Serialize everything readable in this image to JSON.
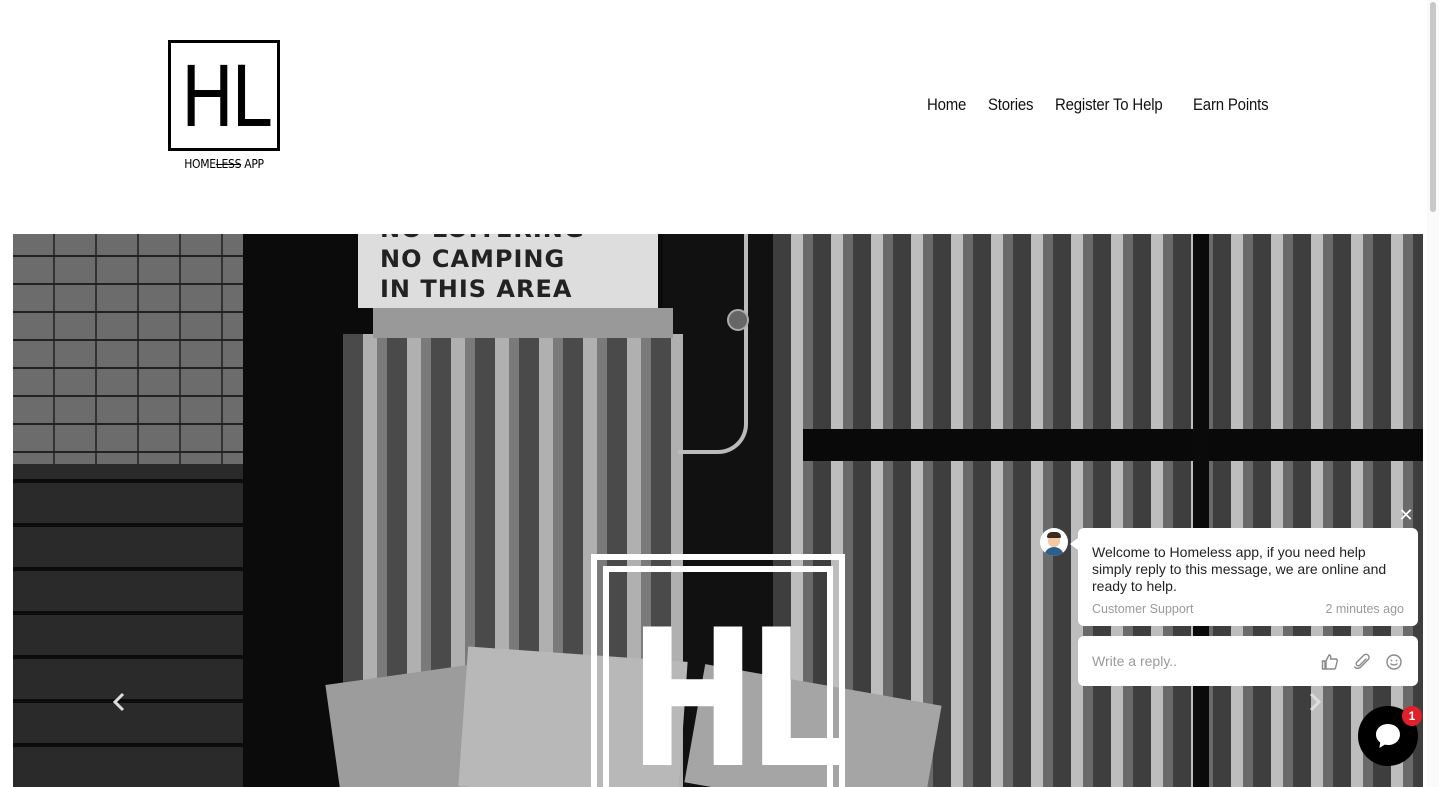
{
  "brand": {
    "logo_letters": "HL",
    "logo_caption_prefix": "HOME",
    "logo_caption_strike": "LESS",
    "logo_caption_suffix": " APP"
  },
  "nav": {
    "items": [
      {
        "label": "Home"
      },
      {
        "label": "Stories"
      },
      {
        "label": "Register To Help"
      },
      {
        "label": "Earn Points"
      }
    ]
  },
  "hero": {
    "sign_lines": [
      "NO LOITERING",
      "NO CAMPING",
      "IN THIS AREA"
    ],
    "logo_letters": "HL",
    "prev_icon": "chevron-left-icon",
    "next_icon": "chevron-right-icon"
  },
  "chat": {
    "message": "Welcome to Homeless app, if you need help simply reply to this message, we are online and ready to help.",
    "sender": "Customer Support",
    "time": "2 minutes ago",
    "reply_placeholder": "Write a reply..",
    "badge_count": "1",
    "icons": [
      "close-icon",
      "thumbs-up-icon",
      "paperclip-icon",
      "emoji-icon",
      "chat-bubble-icon"
    ]
  }
}
